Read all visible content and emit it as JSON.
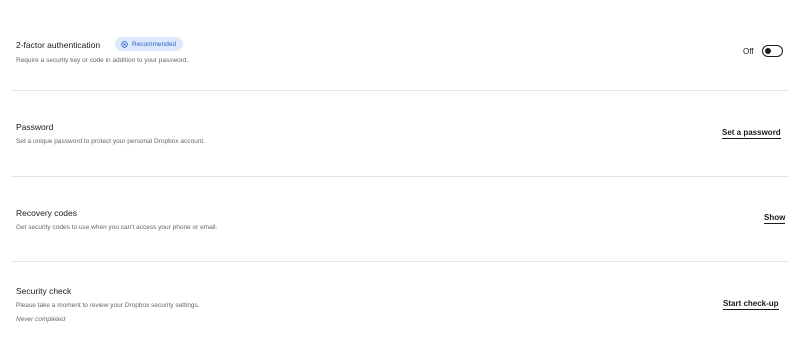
{
  "two_factor": {
    "title": "2-factor authentication",
    "badge": "Recommended",
    "description": "Require a security key or code in addition to your password.",
    "toggle_state": "Off"
  },
  "password": {
    "title": "Password",
    "description": "Set a unique password to protect your personal Dropbox account.",
    "action": "Set a password"
  },
  "recovery_codes": {
    "title": "Recovery codes",
    "description": "Get security codes to use when you can't access your phone or email.",
    "action": "Show"
  },
  "security_check": {
    "title": "Security check",
    "description": "Please take a moment to review your Dropbox security settings.",
    "note": "Never completed",
    "action": "Start check-up"
  },
  "colors": {
    "badge_bg": "#dce9fb",
    "badge_text": "#2f63c8",
    "divider": "#e6e4e0",
    "text": "#1e1919",
    "muted": "#6b6660"
  }
}
